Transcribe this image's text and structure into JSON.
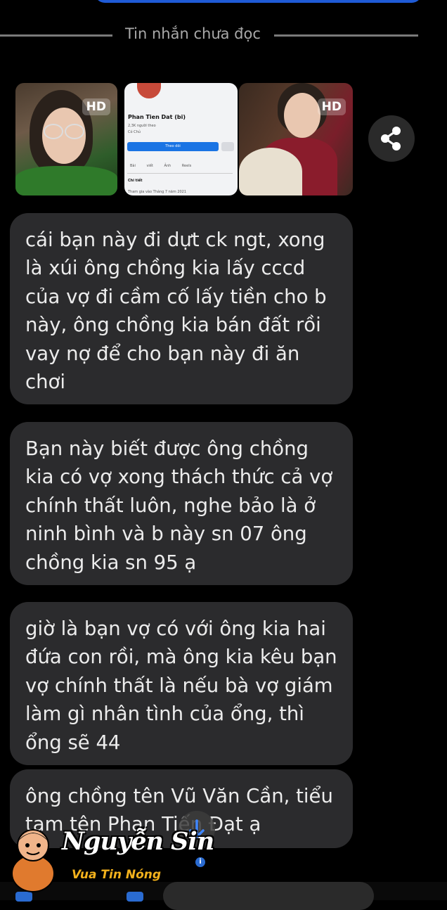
{
  "conversation": {
    "unread_divider": "Tin nhắn chưa đọc",
    "photos": [
      {
        "badge": "HD"
      },
      {
        "profile_name": "Phan Tien Dat (bi)",
        "followers": "2,3K người theo",
        "tag": "Có Chủ",
        "follow_button": "Theo dõi",
        "tabs": "Bài viết Ảnh Reels",
        "details_heading": "Chi tiết",
        "joined": "Tham gia vào Tháng 7 năm 2021"
      },
      {
        "badge": "HD"
      }
    ],
    "messages": [
      "cái bạn này đi dựt ck ngt, xong\nlà xúi ông chồng kia lấy cccd\ncủa vợ đi cầm cố lấy tiền cho b\nnày, ông chồng kia bán đất rồi\nvay nợ để cho bạn này đi ăn\nchơi",
      "Bạn này biết được ông chồng\nkia có vợ xong thách thức cả vợ\nchính thất luôn, nghe bảo là ở\nninh bình và b này sn 07 ông\nchồng kia sn 95 ạ",
      "giờ là bạn vợ có với ông kia hai\nđứa con rồi, mà ông kia kêu bạn\nvợ chính thất là nếu bà vợ giám\nlàm gì nhân tình của ổng, thì\nổng sẽ 44",
      "ông chồng tên Vũ Văn Cần, tiểu\ntam tên Phan Tiến Đạt ạ"
    ]
  },
  "watermark": {
    "name": "Nguyễn Sin",
    "slogan": "Vua Tin Nóng"
  },
  "icons": {
    "share": "share-icon",
    "scroll_down": "arrow-down-icon",
    "info": "info-icon"
  },
  "colors": {
    "bubble": "#2b2b2d",
    "accent_blue": "#1f5bd6",
    "slogan": "#f2b11c"
  }
}
